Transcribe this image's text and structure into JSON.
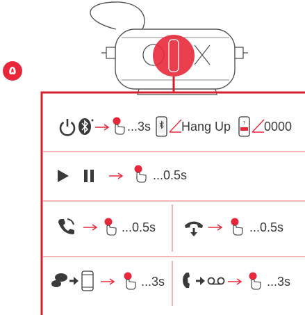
{
  "step": {
    "number": "۵"
  },
  "colors": {
    "accent": "#e8283a",
    "ink": "#3a3a3a",
    "divider": "#e86a72",
    "line": "#d51f2e"
  },
  "rows": {
    "power": {
      "duration": "...3s",
      "hangup_label": "Hang Up",
      "pin_code": "0000",
      "icons": [
        "power-icon",
        "bluetooth-icon",
        "arrow-right-icon",
        "finger-press-icon",
        "phone-bluetooth-icon",
        "phone-hangup-icon",
        "phone-pin-icon"
      ]
    },
    "play_pause": {
      "duration": "...0.5s",
      "icons": [
        "play-icon",
        "pause-icon",
        "arrow-right-icon",
        "finger-press-icon"
      ]
    },
    "answer_call": {
      "duration": "...0.5s",
      "icons": [
        "phone-ring-icon",
        "arrow-right-icon",
        "finger-press-icon"
      ]
    },
    "end_call": {
      "duration": "...0.5s",
      "icons": [
        "hangup-down-icon",
        "arrow-right-icon",
        "finger-press-icon"
      ]
    },
    "transfer_call": {
      "duration": "...3s",
      "icons": [
        "headset-icon",
        "arrow-right-icon",
        "phone-icon",
        "arrow-right-icon",
        "finger-press-icon"
      ]
    },
    "voicemail": {
      "duration": "...3s",
      "icons": [
        "phone-ring-icon",
        "arrow-right-icon",
        "voicemail-icon",
        "arrow-right-icon",
        "finger-press-icon"
      ]
    }
  }
}
